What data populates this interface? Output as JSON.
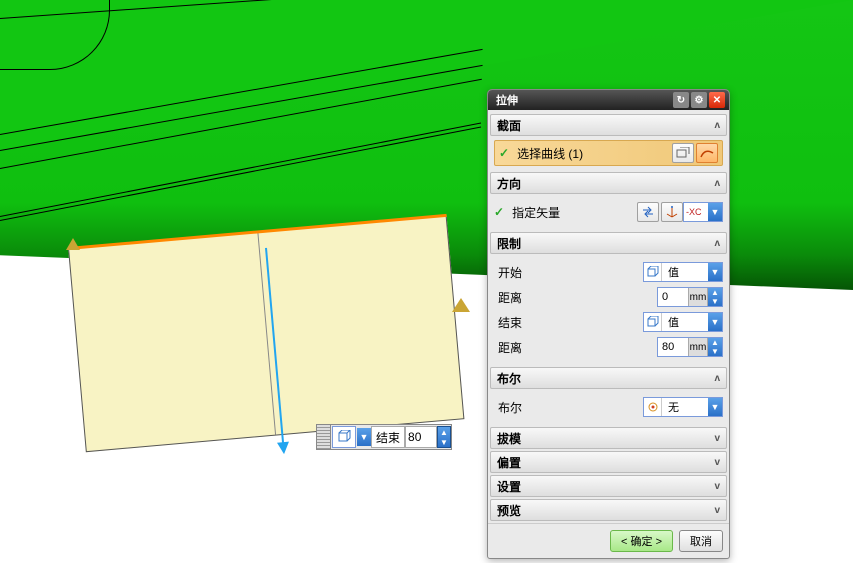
{
  "dialog": {
    "title": "拉伸",
    "sections": {
      "section": {
        "header": "截面",
        "select_curve": "选择曲线 (1)"
      },
      "direction": {
        "header": "方向",
        "specify_vector": "指定矢量",
        "vector_label": "-XC"
      },
      "limits": {
        "header": "限制",
        "start_label": "开始",
        "start_type": "值",
        "start_dist_label": "距离",
        "start_dist_value": "0",
        "end_label": "结束",
        "end_type": "值",
        "end_dist_label": "距离",
        "end_dist_value": "80",
        "unit": "mm"
      },
      "boolean": {
        "header": "布尔",
        "label": "布尔",
        "value": "无"
      },
      "draft": {
        "header": "拔模"
      },
      "offset": {
        "header": "偏置"
      },
      "settings": {
        "header": "设置"
      },
      "preview": {
        "header": "预览"
      }
    },
    "buttons": {
      "ok": "< 确定 >",
      "cancel": "取消"
    }
  },
  "inline": {
    "label": "结束",
    "value": "80"
  },
  "icons": {
    "cube": "◫",
    "reload": "↻",
    "gear": "⚙",
    "close": "✕",
    "checkmark": "✓",
    "sketch": "⧉",
    "curve": "〰",
    "vector_cross": "✕",
    "vector_axes": "⤡",
    "none_circle": "◉",
    "chevron_up": "ʌ",
    "chevron_down": "v",
    "tri_down": "▼",
    "spin_up": "▲",
    "spin_down": "▼"
  }
}
